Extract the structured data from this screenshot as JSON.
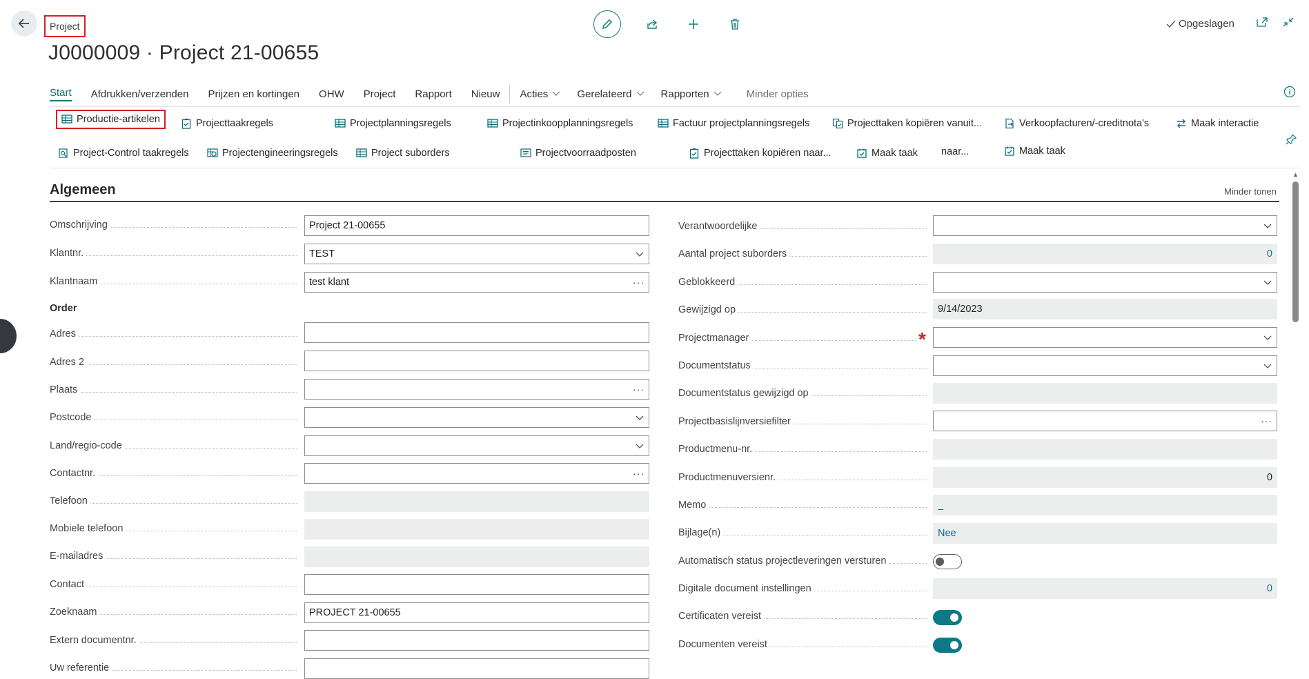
{
  "header": {
    "breadcrumb": "Project",
    "title": "J0000009 · Project 21-00655",
    "saved_status": "Opgeslagen",
    "icons": [
      "back-arrow-icon",
      "edit-pencil-icon",
      "share-icon",
      "plus-icon",
      "trash-icon",
      "popout-icon",
      "collapse-icon"
    ]
  },
  "tabs": {
    "items": [
      "Start",
      "Afdrukken/verzenden",
      "Prijzen en kortingen",
      "OHW",
      "Project",
      "Rapport",
      "Nieuw"
    ],
    "dropdowns": [
      "Acties",
      "Gerelateerd",
      "Rapporten"
    ],
    "less_options": "Minder opties"
  },
  "actions": {
    "row1": [
      "Productie-artikelen",
      "Projecttaakregels",
      "Projectplanningsregels",
      "Projectinkoopplanningsregels",
      "Factuur projectplanningsregels",
      "Projecttaken kopiëren vanuit...",
      "Verkoopfacturen/-creditnota's",
      "Maak interactie"
    ],
    "row2": [
      "Project-Control taakregels",
      "Projectengineeringsregels",
      "Project suborders",
      "Projectvoorraadposten",
      "Projecttaken kopiëren naar...",
      "Maak taak",
      "\t naar...",
      "Maak taak"
    ]
  },
  "section": {
    "title": "Algemeen",
    "less_show": "Minder tonen"
  },
  "left_fields": {
    "omschrijving": {
      "label": "Omschrijving",
      "value": "Project 21-00655"
    },
    "klantnr": {
      "label": "Klantnr.",
      "value": "TEST"
    },
    "klantnaam": {
      "label": "Klantnaam",
      "value": "test klant"
    },
    "order_heading": "Order",
    "adres": {
      "label": "Adres",
      "value": ""
    },
    "adres2": {
      "label": "Adres 2",
      "value": ""
    },
    "plaats": {
      "label": "Plaats",
      "value": ""
    },
    "postcode": {
      "label": "Postcode",
      "value": ""
    },
    "land": {
      "label": "Land/regio-code",
      "value": ""
    },
    "contactnr": {
      "label": "Contactnr.",
      "value": ""
    },
    "telefoon": {
      "label": "Telefoon",
      "value": ""
    },
    "mobiel": {
      "label": "Mobiele telefoon",
      "value": ""
    },
    "email": {
      "label": "E-mailadres",
      "value": ""
    },
    "contact": {
      "label": "Contact",
      "value": ""
    },
    "zoeknaam": {
      "label": "Zoeknaam",
      "value": "PROJECT 21-00655"
    },
    "extern": {
      "label": "Extern documentnr.",
      "value": ""
    },
    "uwref": {
      "label": "Uw referentie",
      "value": ""
    }
  },
  "right_fields": {
    "verantwoordelijke": {
      "label": "Verantwoordelijke",
      "value": ""
    },
    "suborders": {
      "label": "Aantal project suborders",
      "value": "0"
    },
    "geblokkeerd": {
      "label": "Geblokkeerd",
      "value": ""
    },
    "gewijzigd": {
      "label": "Gewijzigd op",
      "value": "9/14/2023"
    },
    "projectmanager": {
      "label": "Projectmanager",
      "value": ""
    },
    "documentstatus": {
      "label": "Documentstatus",
      "value": ""
    },
    "docstatus_gewijzigd": {
      "label": "Documentstatus gewijzigd op",
      "value": ""
    },
    "basislijn": {
      "label": "Projectbasislijnversiefilter",
      "value": ""
    },
    "productmenu": {
      "label": "Productmenu-nr.",
      "value": ""
    },
    "productmenuversie": {
      "label": "Productmenuversienr.",
      "value": "0"
    },
    "memo": {
      "label": "Memo",
      "value": "_"
    },
    "bijlage": {
      "label": "Bijlage(n)",
      "value": "Nee"
    },
    "auto_status": {
      "label": "Automatisch status projectleveringen versturen",
      "on": false
    },
    "digitale": {
      "label": "Digitale document instellingen",
      "value": "0"
    },
    "certificaten": {
      "label": "Certificaten vereist",
      "on": true
    },
    "documenten": {
      "label": "Documenten vereist",
      "on": true
    }
  },
  "colors": {
    "accent": "#0b7a84",
    "highlight": "#d22020",
    "required": "#c42a2a"
  }
}
